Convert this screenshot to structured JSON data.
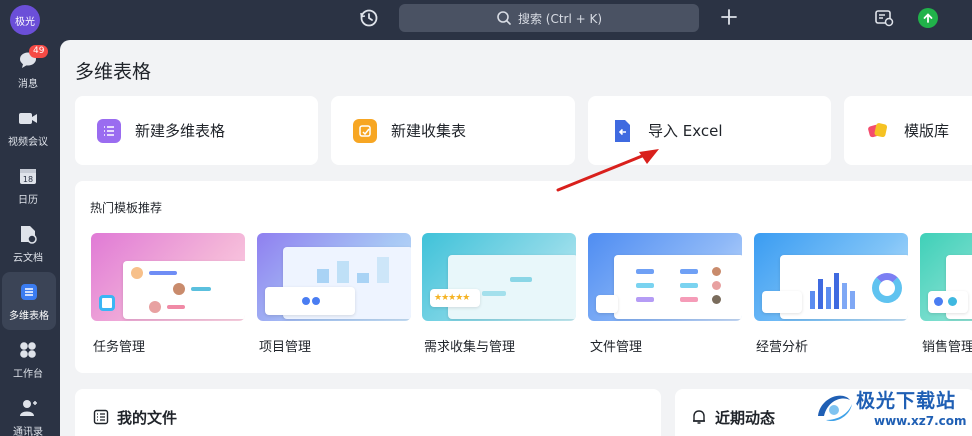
{
  "topbar": {
    "avatar_text": "极光",
    "search_placeholder": "搜索 (Ctrl + K)"
  },
  "sidebar": {
    "items": [
      {
        "label": "消息",
        "badge": "49",
        "icon": "message-icon"
      },
      {
        "label": "视频会议",
        "icon": "video-icon"
      },
      {
        "label": "日历",
        "icon": "calendar-icon",
        "icon_text": "18"
      },
      {
        "label": "云文档",
        "icon": "cloud-doc-icon"
      },
      {
        "label": "多维表格",
        "icon": "bitable-icon",
        "active": true
      },
      {
        "label": "工作台",
        "icon": "workspace-icon"
      },
      {
        "label": "通讯录",
        "icon": "contacts-icon"
      }
    ]
  },
  "main": {
    "title": "多维表格",
    "actions": [
      {
        "label": "新建多维表格",
        "icon": "new-bitable-icon",
        "color": "#9a6cf0"
      },
      {
        "label": "新建收集表",
        "icon": "new-form-icon",
        "color": "#f7a623"
      },
      {
        "label": "导入 Excel",
        "icon": "import-excel-icon",
        "color": "#3f6ae0"
      },
      {
        "label": "模版库",
        "icon": "template-library-icon",
        "color": "#f5c223"
      }
    ],
    "templates_title": "热门模板推荐",
    "templates": [
      {
        "name": "任务管理"
      },
      {
        "name": "项目管理"
      },
      {
        "name": "需求收集与管理"
      },
      {
        "name": "文件管理"
      },
      {
        "name": "经营分析"
      },
      {
        "name": "销售管理"
      }
    ],
    "my_files_title": "我的文件",
    "recent_activity_title": "近期动态"
  },
  "watermark": {
    "title": "极光下载站",
    "url": "www.xz7.com"
  },
  "colors": {
    "sidebar_bg": "#2b3344",
    "main_bg": "#f2f3f5",
    "annotation_arrow": "#d9201c"
  }
}
